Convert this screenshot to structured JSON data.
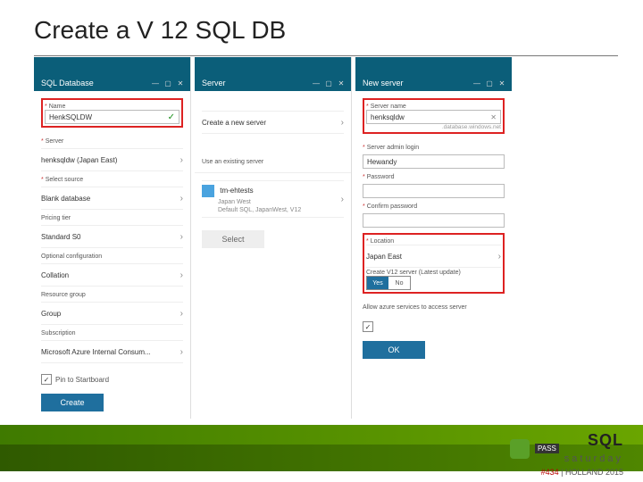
{
  "slide": {
    "title": "Create a V 12 SQL DB"
  },
  "blade1": {
    "header": "SQL Database",
    "name_label": "Name",
    "name_value": "HenkSQLDW",
    "server_label": "Server",
    "server_value": "henksqldw (Japan East)",
    "source_label": "Select source",
    "source_value": "Blank database",
    "tier_label": "Pricing tier",
    "tier_value": "Standard S0",
    "config_label": "Optional configuration",
    "config_value": "Collation",
    "rg_label": "Resource group",
    "rg_value": "Group",
    "sub_label": "Subscription",
    "sub_value": "Microsoft Azure Internal Consum...",
    "pin": "Pin to Startboard",
    "create": "Create"
  },
  "blade2": {
    "header": "Server",
    "newserver": "Create a new server",
    "existing_label": "Use an existing server",
    "existing_name": "tm-ehtests",
    "existing_loc": "Japan West",
    "existing_ver": "Default SQL, JapanWest, V12",
    "select": "Select"
  },
  "blade3": {
    "header": "New server",
    "sname_label": "Server name",
    "sname_value": "henksqldw",
    "sname_suffix": ".database.windows.net",
    "login_label": "Server admin login",
    "login_value": "Hewandy",
    "pwd_label": "Password",
    "cpwd_label": "Confirm password",
    "loc_label": "Location",
    "loc_value": "Japan East",
    "v12_label": "Create V12 server (Latest update)",
    "v12_yes": "Yes",
    "v12_no": "No",
    "allow_label": "Allow azure services to access server",
    "ok": "OK"
  },
  "footer": {
    "tag_num": "#434",
    "tag_loc": "HOLLAND 2015",
    "sql": "SQL",
    "sat": "saturday",
    "pass": "PASS"
  }
}
